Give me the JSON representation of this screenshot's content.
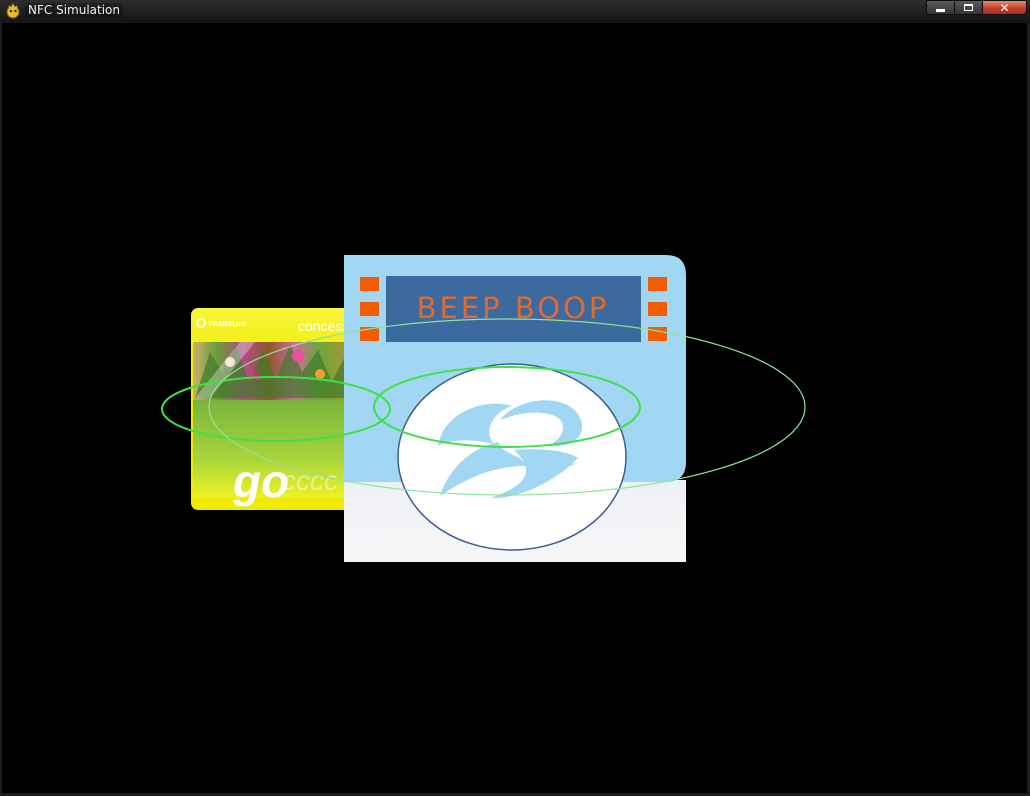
{
  "window": {
    "title": "NFC Simulation",
    "controls": {
      "minimize_icon": "minimize-icon",
      "maximize_icon": "maximize-icon",
      "close_icon": "close-icon"
    }
  },
  "scene": {
    "card": {
      "brand": "TRANSLink",
      "label": "concession",
      "logo_text": "go",
      "tail_text": "cccc"
    },
    "reader": {
      "screen_text": "BEEP BOOP",
      "logo_icon": "translink-swirl-icon"
    },
    "field_rings": "nfc-field-ellipses"
  },
  "colors": {
    "background": "#000000",
    "card_yellow": "#f5f10a",
    "card_green": "#7bc043",
    "reader_blue": "#a2d7f4",
    "screen_blue": "#3d6a9e",
    "screen_text": "#e26a2a",
    "indicator_orange": "#f25c05",
    "ring_green": "#3fe046"
  }
}
